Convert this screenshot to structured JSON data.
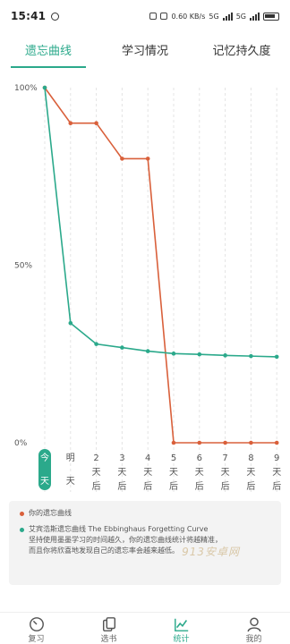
{
  "status_bar": {
    "time": "15:41",
    "net_speed": "0.60 KB/s",
    "signal_1": "5G",
    "signal_2": "5G"
  },
  "tabs": [
    {
      "label": "遗忘曲线",
      "active": true
    },
    {
      "label": "学习情况",
      "active": false
    },
    {
      "label": "记忆持久度",
      "active": false
    }
  ],
  "chart_data": {
    "type": "line",
    "x": [
      "今天",
      "明天",
      "2天后",
      "3天后",
      "4天后",
      "5天后",
      "6天后",
      "7天后",
      "8天后",
      "9天后"
    ],
    "y_tick_labels": [
      "100%",
      "50%",
      "0%"
    ],
    "ylim": [
      0,
      100
    ],
    "series": [
      {
        "name": "你的遗忘曲线",
        "color": "#d9603b",
        "values": [
          100,
          90,
          90,
          80,
          80,
          0,
          0,
          0,
          0,
          0
        ]
      },
      {
        "name": "艾宾浩斯遗忘曲线 The Ebbinghaus Forgetting Curve",
        "color": "#2ba98b",
        "values": [
          100,
          33.7,
          27.8,
          26.8,
          25.8,
          25.1,
          24.9,
          24.6,
          24.4,
          24.2
        ]
      }
    ],
    "highlight_index": 0,
    "highlight_color": "#2ba98b"
  },
  "legend": {
    "item_1": "你的遗忘曲线",
    "item_2": "艾宾浩斯遗忘曲线 The Ebbinghaus Forgetting Curve",
    "description_1": "坚持使用墨墨学习的时间越久，你的遗忘曲线统计将越精准，",
    "description_2": "而且你将欣喜地发现自己的遗忘率会越来越低。",
    "watermark": "913安卓网"
  },
  "bottom_nav": [
    {
      "label": "复习",
      "icon": "timer-icon",
      "active": false
    },
    {
      "label": "选书",
      "icon": "cards-icon",
      "active": false
    },
    {
      "label": "统计",
      "icon": "chart-icon",
      "active": true
    },
    {
      "label": "我的",
      "icon": "person-icon",
      "active": false
    }
  ],
  "colors": {
    "accent": "#2ba98b",
    "user_curve": "#d9603b"
  }
}
